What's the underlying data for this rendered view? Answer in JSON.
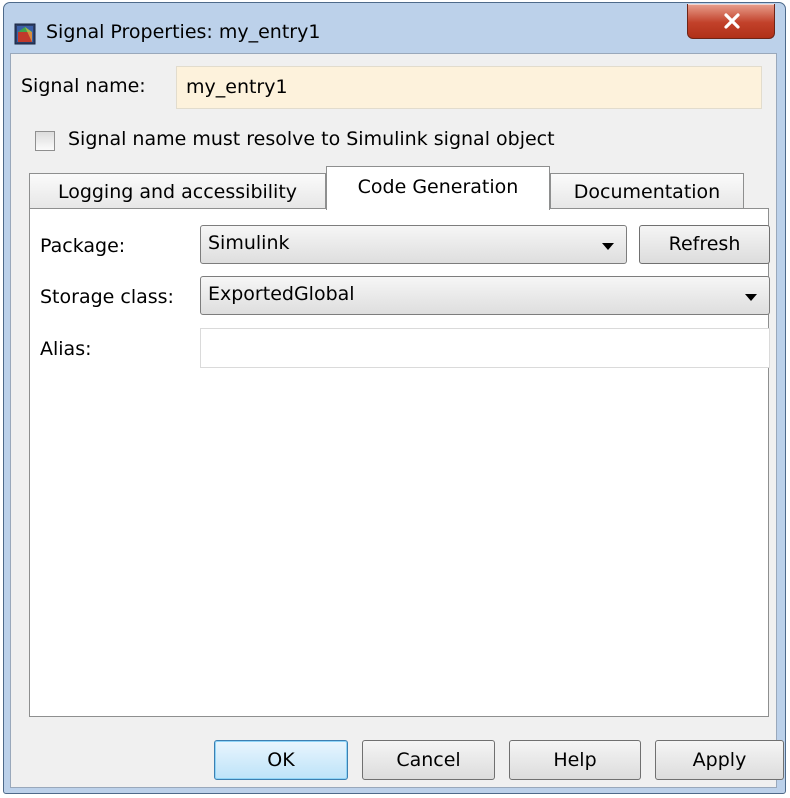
{
  "window": {
    "title": "Signal Properties: my_entry1",
    "icons": {
      "app": "simulink-block-icon",
      "close": "close-x-icon"
    }
  },
  "signal": {
    "name_label": "Signal name:",
    "name_value": "my_entry1",
    "resolve_label": "Signal name must resolve to Simulink signal object",
    "resolve_checked": false
  },
  "tabs": [
    {
      "label": "Logging and accessibility",
      "active": false
    },
    {
      "label": "Code Generation",
      "active": true
    },
    {
      "label": "Documentation",
      "active": false
    }
  ],
  "code_generation": {
    "package_label": "Package:",
    "package_value": "Simulink",
    "refresh_label": "Refresh",
    "storage_class_label": "Storage class:",
    "storage_class_value": "ExportedGlobal",
    "alias_label": "Alias:",
    "alias_value": ""
  },
  "buttons": {
    "ok": "OK",
    "cancel": "Cancel",
    "help": "Help",
    "apply": "Apply"
  },
  "colors": {
    "signal_input_bg": "#fdf2dc",
    "default_button": "#bde3f9",
    "close_button": "#c2412a"
  }
}
